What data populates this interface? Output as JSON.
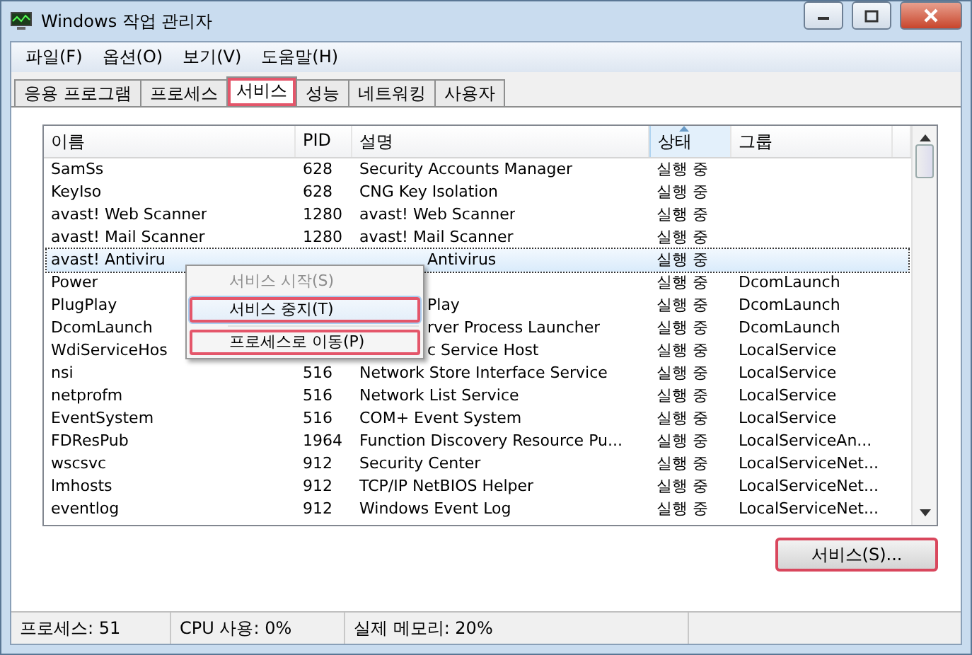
{
  "window": {
    "title": "Windows 작업 관리자"
  },
  "menu_bar": [
    "파일(F)",
    "옵션(O)",
    "보기(V)",
    "도움말(H)"
  ],
  "tabs": [
    {
      "label": "응용 프로그램",
      "selected": false,
      "highlighted": false
    },
    {
      "label": "프로세스",
      "selected": false,
      "highlighted": false
    },
    {
      "label": "서비스",
      "selected": true,
      "highlighted": true
    },
    {
      "label": "성능",
      "selected": false,
      "highlighted": false
    },
    {
      "label": "네트워킹",
      "selected": false,
      "highlighted": false
    },
    {
      "label": "사용자",
      "selected": false,
      "highlighted": false
    }
  ],
  "table": {
    "columns": [
      {
        "label": "이름",
        "sorted": false
      },
      {
        "label": "PID",
        "sorted": false
      },
      {
        "label": "설명",
        "sorted": false
      },
      {
        "label": "상태",
        "sorted": true
      },
      {
        "label": "그룹",
        "sorted": false
      }
    ],
    "rows": [
      {
        "name": "SamSs",
        "pid": "628",
        "description": "Security Accounts Manager",
        "status": "실행 중",
        "group": "",
        "selected": false,
        "covered": false
      },
      {
        "name": "KeyIso",
        "pid": "628",
        "description": "CNG Key Isolation",
        "status": "실행 중",
        "group": "",
        "selected": false,
        "covered": false
      },
      {
        "name": "avast! Web Scanner",
        "pid": "1280",
        "description": "avast! Web Scanner",
        "status": "실행 중",
        "group": "",
        "selected": false,
        "covered": false
      },
      {
        "name": "avast! Mail Scanner",
        "pid": "1280",
        "description": "avast! Mail Scanner",
        "status": "실행 중",
        "group": "",
        "selected": false,
        "covered": false
      },
      {
        "name": "avast! Antiviru",
        "pid": "",
        "description": "Antivirus",
        "status": "실행 중",
        "group": "",
        "selected": true,
        "covered": true
      },
      {
        "name": "Power",
        "pid": "",
        "description": "",
        "status": "실행 중",
        "group": "DcomLaunch",
        "selected": false
      },
      {
        "name": "PlugPlay",
        "pid": "",
        "description": "Play",
        "status": "실행 중",
        "group": "DcomLaunch",
        "selected": false,
        "covered": true
      },
      {
        "name": "DcomLaunch",
        "pid": "",
        "description": "rver Process Launcher",
        "status": "실행 중",
        "group": "DcomLaunch",
        "selected": false,
        "covered": true
      },
      {
        "name": "WdiServiceHos",
        "pid": "",
        "description": "c Service Host",
        "status": "실행 중",
        "group": "LocalService",
        "selected": false,
        "covered": true
      },
      {
        "name": "nsi",
        "pid": "516",
        "description": "Network Store Interface Service",
        "status": "실행 중",
        "group": "LocalService",
        "selected": false,
        "covered": false
      },
      {
        "name": "netprofm",
        "pid": "516",
        "description": "Network List Service",
        "status": "실행 중",
        "group": "LocalService",
        "selected": false,
        "covered": false
      },
      {
        "name": "EventSystem",
        "pid": "516",
        "description": "COM+ Event System",
        "status": "실행 중",
        "group": "LocalService",
        "selected": false,
        "covered": false
      },
      {
        "name": "FDResPub",
        "pid": "1964",
        "description": "Function Discovery Resource Pu...",
        "status": "실행 중",
        "group": "LocalServiceAn...",
        "selected": false,
        "covered": false
      },
      {
        "name": "wscsvc",
        "pid": "912",
        "description": "Security Center",
        "status": "실행 중",
        "group": "LocalServiceNet...",
        "selected": false,
        "covered": false
      },
      {
        "name": "lmhosts",
        "pid": "912",
        "description": "TCP/IP NetBIOS Helper",
        "status": "실행 중",
        "group": "LocalServiceNet...",
        "selected": false,
        "covered": false
      },
      {
        "name": "eventlog",
        "pid": "912",
        "description": "Windows Event Log",
        "status": "실행 중",
        "group": "LocalServiceNet...",
        "selected": false,
        "covered": false
      }
    ]
  },
  "context_menu": [
    {
      "label": "서비스 시작(S)",
      "disabled": true,
      "hovered": false,
      "highlighted": false
    },
    {
      "label": "서비스 중지(T)",
      "disabled": false,
      "hovered": true,
      "highlighted": true
    },
    {
      "label": "프로세스로 이동(P)",
      "disabled": false,
      "hovered": false,
      "highlighted": true
    }
  ],
  "services_button": {
    "label": "서비스(S)...",
    "highlighted": true
  },
  "status_bar": [
    "프로세스: 51",
    "CPU 사용: 0%",
    "실제 메모리: 20%"
  ]
}
